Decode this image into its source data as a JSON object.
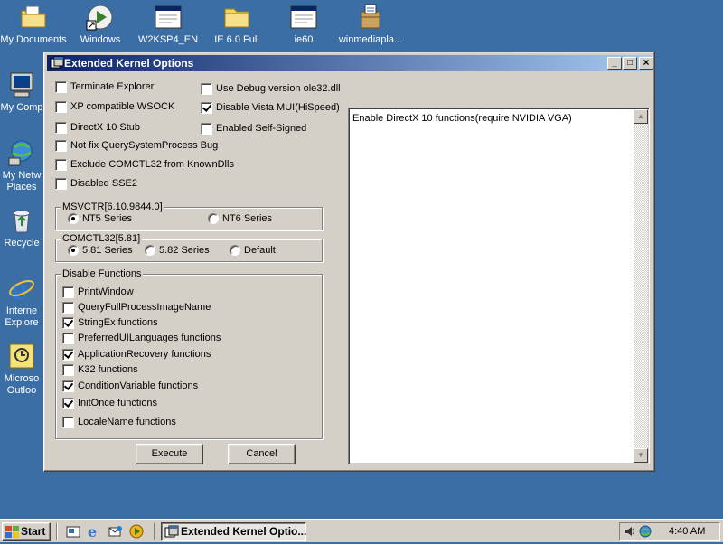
{
  "desktop": {
    "icons": [
      {
        "label": "My Documents",
        "icon": "folder-documents-icon"
      },
      {
        "label": "Windows",
        "icon": "media-player-shortcut-icon"
      },
      {
        "label": "W2KSP4_EN",
        "icon": "window-app-icon"
      },
      {
        "label": "IE 6.0 Full",
        "icon": "folder-icon"
      },
      {
        "label": "ie60",
        "icon": "window-app-icon"
      },
      {
        "label": "winmediapla...",
        "icon": "installer-package-icon"
      },
      {
        "label": "My Comp",
        "icon": "computer-icon"
      },
      {
        "label": "My Netw",
        "label2": "Places",
        "icon": "network-places-icon"
      },
      {
        "label": "Recycle",
        "icon": "recycle-bin-icon"
      },
      {
        "label": "Interne",
        "label2": "Explore",
        "icon": "internet-explorer-icon"
      },
      {
        "label": "Microso",
        "label2": "Outloo",
        "icon": "outlook-icon"
      }
    ]
  },
  "window": {
    "title": "Extended Kernel Options",
    "controls": {
      "minimize": "_",
      "maximize": "□",
      "close": "×"
    },
    "options_left": [
      {
        "label": "Terminate Explorer",
        "checked": false
      },
      {
        "label": "XP compatible WSOCK",
        "checked": false
      },
      {
        "label": "DirectX 10 Stub",
        "checked": false
      },
      {
        "label": "Not fix QuerySystemProcess Bug",
        "checked": false
      },
      {
        "label": "Exclude COMCTL32 from KnownDlls",
        "checked": false
      },
      {
        "label": "Disabled SSE2",
        "checked": false
      }
    ],
    "options_right": [
      {
        "label": "Use Debug version ole32.dll",
        "checked": false
      },
      {
        "label": "Disable Vista MUI(HiSpeed)",
        "checked": true
      },
      {
        "label": "Enabled Self-Signed",
        "checked": false
      }
    ],
    "msvctr": {
      "legend": "MSVCTR[6.10.9844.0]",
      "options": [
        {
          "label": "NT5 Series",
          "selected": true
        },
        {
          "label": "NT6 Series",
          "selected": false
        }
      ]
    },
    "comctl32": {
      "legend": "COMCTL32[5.81]",
      "options": [
        {
          "label": "5.81 Series",
          "selected": true
        },
        {
          "label": "5.82 Series",
          "selected": false
        },
        {
          "label": "Default",
          "selected": false
        }
      ]
    },
    "disable_functions": {
      "legend": "Disable Functions",
      "items": [
        {
          "label": "PrintWindow",
          "checked": false
        },
        {
          "label": "QueryFullProcessImageName",
          "checked": false
        },
        {
          "label": "StringEx functions",
          "checked": true
        },
        {
          "label": "PreferredUILanguages functions",
          "checked": false
        },
        {
          "label": "ApplicationRecovery functions",
          "checked": true
        },
        {
          "label": "K32 functions",
          "checked": false
        },
        {
          "label": "ConditionVariable functions",
          "checked": true
        },
        {
          "label": "InitOnce functions",
          "checked": true
        },
        {
          "label": "LocaleName functions",
          "checked": false
        }
      ]
    },
    "buttons": {
      "execute": "Execute",
      "cancel": "Cancel"
    },
    "description": "Enable DirectX 10 functions(require NVIDIA VGA)"
  },
  "taskbar": {
    "start_label": "Start",
    "quick_launch": [
      "show-desktop-icon",
      "internet-explorer-icon",
      "outlook-express-icon",
      "media-player-icon"
    ],
    "task_label": "Extended Kernel Optio...",
    "clock": "4:40 AM"
  }
}
